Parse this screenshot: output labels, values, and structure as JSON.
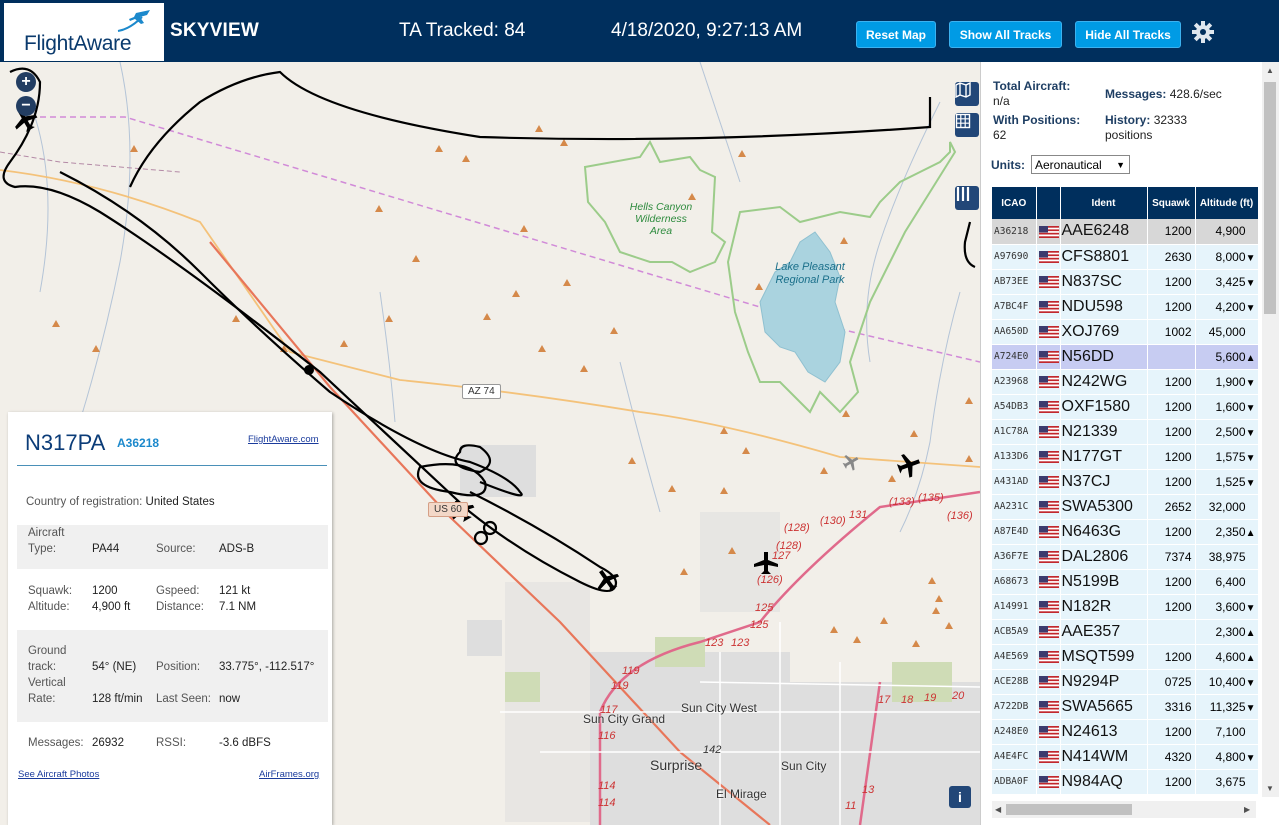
{
  "header": {
    "logo_text": "FlightAware",
    "site_name": "SKYVIEW",
    "ta_tracked": "TA Tracked: 84",
    "datetime": "4/18/2020, 9:27:13 AM",
    "btn_reset": "Reset Map",
    "btn_show": "Show All Tracks",
    "btn_hide": "Hide All Tracks"
  },
  "map": {
    "zoom_in": "+",
    "zoom_out": "−",
    "info_btn": "i",
    "labels": {
      "hells_canyon": "Hells Canyon Wilderness Area",
      "lake_pleasant": "Lake Pleasant Regional Park",
      "az74": "AZ 74",
      "us60": "US 60",
      "sun_city_grand": "Sun City Grand",
      "sun_city_west": "Sun City West",
      "surprise": "Surprise",
      "sun_city": "Sun City",
      "el_mirage": "El Mirage",
      "r128a": "(128)",
      "r128b": "(128)",
      "r130": "(130)",
      "r131": "131",
      "r133": "(133)",
      "r135": "(135)",
      "r136": "(136)",
      "r127": "127",
      "r126": "(126)",
      "r125a": "125",
      "r125b": "125",
      "r123a": "123",
      "r123b": "123",
      "r119a": "119",
      "r119b": "119",
      "r117": "117",
      "r116": "116",
      "r114a": "114",
      "r114b": "114",
      "r142": "142",
      "r17": "17",
      "r18": "18",
      "r19": "19",
      "r20": "20",
      "r13": "13",
      "r11": "11"
    }
  },
  "info": {
    "callsign": "N317PA",
    "icao": "A36218",
    "fa_link": "FlightAware.com",
    "country_label": "Country of registration:",
    "country": "United States",
    "aircraft_label": "Aircraft",
    "type_label": "Type:",
    "type": "PA44",
    "source_label": "Source:",
    "source": "ADS-B",
    "squawk_label": "Squawk:",
    "squawk": "1200",
    "gspeed_label": "Gspeed:",
    "gspeed": "121 kt",
    "altitude_label": "Altitude:",
    "altitude": "4,900 ft",
    "distance_label": "Distance:",
    "distance": "7.1 NM",
    "ground_label": "Ground",
    "track_label": "track:",
    "track": "54° (NE)",
    "position_label": "Position:",
    "position": "33.775°, -112.517°",
    "vertical_label": "Vertical",
    "rate_label": "Rate:",
    "rate": "128 ft/min",
    "last_seen_label": "Last Seen:",
    "last_seen": "now",
    "messages_label": "Messages:",
    "messages": "26932",
    "rssi_label": "RSSI:",
    "rssi": "-3.6 dBFS",
    "photos_link": "See Aircraft Photos",
    "airframes_link": "AirFrames.org"
  },
  "sidebar": {
    "total_label": "Total Aircraft:",
    "total": "n/a",
    "messages_label": "Messages:",
    "messages": "428.6/sec",
    "with_pos_label": "With Positions:",
    "with_pos": "62",
    "history_label": "History:",
    "history": "32333 positions",
    "units_label": "Units:",
    "units_value": "Aeronautical",
    "columns": [
      "ICAO",
      "",
      "Ident",
      "Squawk",
      "Altitude (ft)"
    ],
    "rows": [
      {
        "icao": "A36218",
        "ident": "AAE6248",
        "squawk": "1200",
        "alt": "4,900",
        "trend": ""
      },
      {
        "icao": "A97690",
        "ident": "CFS8801",
        "squawk": "2630",
        "alt": "8,000",
        "trend": "▼"
      },
      {
        "icao": "AB73EE",
        "ident": "N837SC",
        "squawk": "1200",
        "alt": "3,425",
        "trend": "▼"
      },
      {
        "icao": "A7BC4F",
        "ident": "NDU598",
        "squawk": "1200",
        "alt": "4,200",
        "trend": "▼"
      },
      {
        "icao": "AA650D",
        "ident": "XOJ769",
        "squawk": "1002",
        "alt": "45,000",
        "trend": ""
      },
      {
        "icao": "A724E0",
        "ident": "N56DD",
        "squawk": "",
        "alt": "5,600",
        "trend": "▲"
      },
      {
        "icao": "A23968",
        "ident": "N242WG",
        "squawk": "1200",
        "alt": "1,900",
        "trend": "▼"
      },
      {
        "icao": "A54DB3",
        "ident": "OXF1580",
        "squawk": "1200",
        "alt": "1,600",
        "trend": "▼"
      },
      {
        "icao": "A1C78A",
        "ident": "N21339",
        "squawk": "1200",
        "alt": "2,500",
        "trend": "▼"
      },
      {
        "icao": "A133D6",
        "ident": "N177GT",
        "squawk": "1200",
        "alt": "1,575",
        "trend": "▼"
      },
      {
        "icao": "A431AD",
        "ident": "N37CJ",
        "squawk": "1200",
        "alt": "1,525",
        "trend": "▼"
      },
      {
        "icao": "AA231C",
        "ident": "SWA5300",
        "squawk": "2652",
        "alt": "32,000",
        "trend": ""
      },
      {
        "icao": "A87E4D",
        "ident": "N6463G",
        "squawk": "1200",
        "alt": "2,350",
        "trend": "▲"
      },
      {
        "icao": "A36F7E",
        "ident": "DAL2806",
        "squawk": "7374",
        "alt": "38,975",
        "trend": ""
      },
      {
        "icao": "A68673",
        "ident": "N5199B",
        "squawk": "1200",
        "alt": "6,400",
        "trend": ""
      },
      {
        "icao": "A14991",
        "ident": "N182R",
        "squawk": "1200",
        "alt": "3,600",
        "trend": "▼"
      },
      {
        "icao": "ACB5A9",
        "ident": "AAE357",
        "squawk": "",
        "alt": "2,300",
        "trend": "▲"
      },
      {
        "icao": "A4E569",
        "ident": "MSQT599",
        "squawk": "1200",
        "alt": "4,600",
        "trend": "▲"
      },
      {
        "icao": "ACE28B",
        "ident": "N9294P",
        "squawk": "0725",
        "alt": "10,400",
        "trend": "▼"
      },
      {
        "icao": "A722DB",
        "ident": "SWA5665",
        "squawk": "3316",
        "alt": "11,325",
        "trend": "▼"
      },
      {
        "icao": "A248E0",
        "ident": "N24613",
        "squawk": "1200",
        "alt": "7,100",
        "trend": ""
      },
      {
        "icao": "A4E4FC",
        "ident": "N414WM",
        "squawk": "4320",
        "alt": "4,800",
        "trend": "▼"
      },
      {
        "icao": "ADBA0F",
        "ident": "N984AQ",
        "squawk": "1200",
        "alt": "3,675",
        "trend": ""
      }
    ]
  },
  "colors": {
    "header_bg": "#002f5d",
    "button": "#009be5",
    "map_bg": "#f2efe9",
    "track": "#000000",
    "park_border": "#9ccc8a",
    "lake": "#aad3df",
    "highway": "#e8765a"
  }
}
